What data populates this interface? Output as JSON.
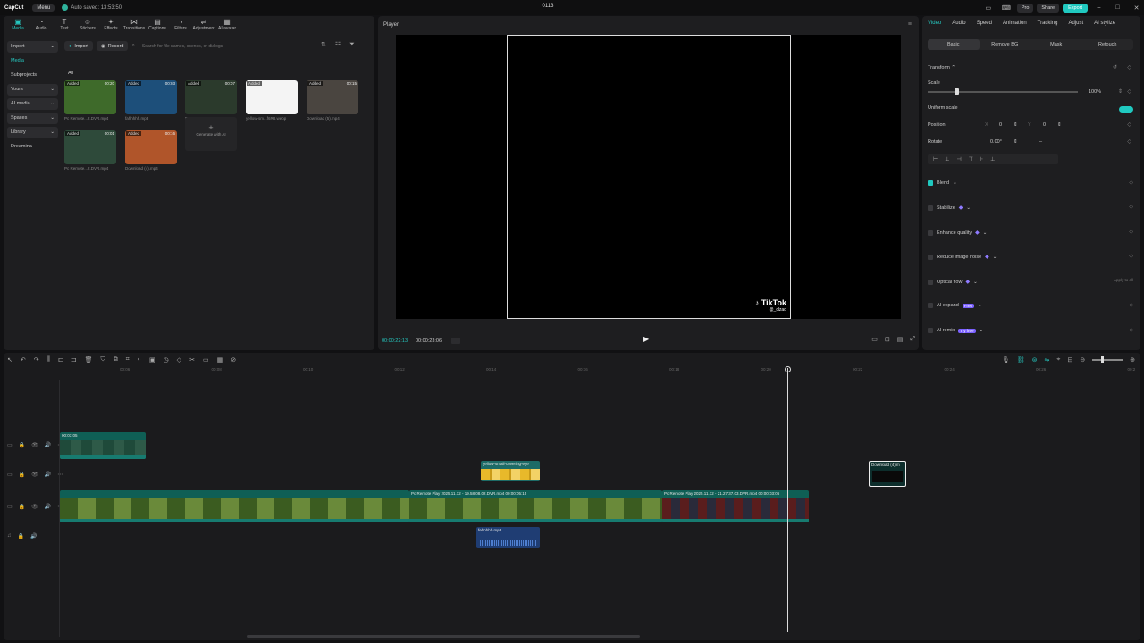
{
  "app": {
    "logo": "CapCut",
    "menu": "Menu",
    "autosave": "Auto saved: 13:53:50",
    "project_title": "0113",
    "pro": "Pro",
    "share": "Share",
    "export": "Export"
  },
  "media_toolbar": [
    {
      "label": "Media",
      "icon": "media-icon"
    },
    {
      "label": "Audio",
      "icon": "audio-icon"
    },
    {
      "label": "Text",
      "icon": "text-icon"
    },
    {
      "label": "Stickers",
      "icon": "stickers-icon"
    },
    {
      "label": "Effects",
      "icon": "effects-icon"
    },
    {
      "label": "Transitions",
      "icon": "transitions-icon"
    },
    {
      "label": "Captions",
      "icon": "captions-icon"
    },
    {
      "label": "Filters",
      "icon": "filters-icon"
    },
    {
      "label": "Adjustment",
      "icon": "adjustment-icon"
    },
    {
      "label": "AI avatar",
      "icon": "ai-avatar-icon"
    }
  ],
  "media_sidebar": [
    {
      "label": "Import",
      "arrow": "⌄"
    },
    {
      "label": "Media",
      "arrow": ""
    },
    {
      "label": "Subprojects",
      "arrow": ""
    },
    {
      "label": "Yours",
      "arrow": "⌄"
    },
    {
      "label": "AI media",
      "arrow": "⌄"
    },
    {
      "label": "Spaces",
      "arrow": "⌄"
    },
    {
      "label": "Library",
      "arrow": "⌄"
    },
    {
      "label": "Dreamina",
      "arrow": ""
    }
  ],
  "media_head": {
    "import": "Import",
    "record": "Record",
    "search_placeholder": "Search for file names, scenes, or dialogs",
    "all": "All"
  },
  "media_items": [
    {
      "name": "Pc Remote...2.DVR.mp4",
      "added": "Added",
      "duration": "00:20",
      "color": "#3e6a2a"
    },
    {
      "name": "fahhhhh.mp3",
      "added": "Added",
      "duration": "00:03",
      "color": "#1d4f7a"
    },
    {
      "name": "Pc Remote...2.DVR.mp4",
      "added": "Added",
      "duration": "00:07",
      "color": "#2b3a2c"
    },
    {
      "name": "yellow-sm...f6R8.webp",
      "added": "Added",
      "duration": "",
      "color": "#f4f4f4"
    },
    {
      "name": "Download (5).mp4",
      "added": "Added",
      "duration": "00:15",
      "color": "#4a4540"
    },
    {
      "name": "Pc Remote...2.DVR.mp4",
      "added": "Added",
      "duration": "00:01",
      "color": "#2e4a3a"
    },
    {
      "name": "Download (4).mp4",
      "added": "Added",
      "duration": "00:16",
      "color": "#b0552a"
    }
  ],
  "generate_ai": "Generate with AI",
  "player": {
    "title": "Player",
    "time_current": "00:00:22:13",
    "time_total": "00:00:23:06",
    "watermark": "TikTok",
    "watermark_user": "@_clzaq"
  },
  "props": {
    "tabs": [
      "Video",
      "Audio",
      "Speed",
      "Animation",
      "Tracking",
      "Adjust",
      "AI stylize"
    ],
    "subtabs": [
      "Basic",
      "Remove BG",
      "Mask",
      "Retouch"
    ],
    "transform": "Transform",
    "scale": "Scale",
    "scale_value": "100%",
    "uniform_scale": "Uniform scale",
    "position": "Position",
    "pos_x_label": "X",
    "pos_x": "0",
    "pos_y_label": "Y",
    "pos_y": "0",
    "rotate": "Rotate",
    "rotate_value": "0.00°",
    "rotate_dash": "–",
    "sections": [
      {
        "label": "Blend",
        "checked": true,
        "badge": "",
        "gem": false
      },
      {
        "label": "Stabilize",
        "checked": false,
        "badge": "",
        "gem": true
      },
      {
        "label": "Enhance quality",
        "checked": false,
        "badge": "",
        "gem": true
      },
      {
        "label": "Reduce image noise",
        "checked": false,
        "badge": "",
        "gem": true
      },
      {
        "label": "Optical flow",
        "checked": false,
        "badge": "",
        "gem": true,
        "right": "Apply to all"
      },
      {
        "label": "AI expand",
        "checked": false,
        "badge": "Free",
        "gem": false
      },
      {
        "label": "AI remix",
        "checked": false,
        "badge": "Try free",
        "gem": false
      }
    ]
  },
  "timeline": {
    "ruler": [
      "00:06",
      "00:08",
      "00:10",
      "00:12",
      "00:14",
      "00:16",
      "00:18",
      "00:20",
      "00:22",
      "00:24",
      "00:26",
      "00:2"
    ],
    "clips": {
      "c1": "00:03:05",
      "sticker": "yellow-smail-covering-eye",
      "download": "Download (4).m",
      "main1": "Pc Remote Play 2025.11.12 - 19.58.08.02.DVR.mp4  00:00:05:15",
      "main2": "Pc Remote Play 2025.11.12 - 21.27.37.03.DVR.mp4  00:00:03:06",
      "audio": "fahhhhh.mp3"
    }
  },
  "colors": {
    "accent": "#20c9c0",
    "panel": "#1e1e20",
    "background": "#111113"
  }
}
